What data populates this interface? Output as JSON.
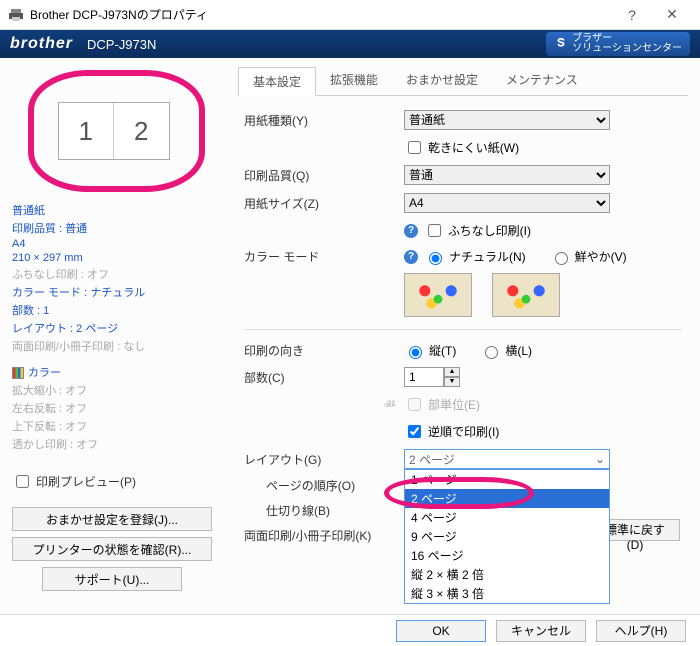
{
  "titlebar": {
    "title": "Brother DCP-J973Nのプロパティ"
  },
  "brandbar": {
    "brand": "brother",
    "model": "DCP-J973N",
    "support": "ブラザー\nソリューションセンター"
  },
  "tabs": [
    "基本設定",
    "拡張機能",
    "おまかせ設定",
    "メンテナンス"
  ],
  "preview": {
    "p1": "1",
    "p2": "2"
  },
  "summary": {
    "media": "普通紙",
    "quality": "印刷品質 : 普通",
    "size": "A4",
    "dim": "210 × 297 mm",
    "borderless": "ふちなし印刷 : オフ",
    "colormode": "カラー モード : ナチュラル",
    "copies": "部数 : 1",
    "layout": "レイアウト : 2 ページ",
    "duplex": "両面印刷/小冊子印刷 : なし",
    "color_head": "カラー",
    "scale": "拡大縮小 : オフ",
    "mirror": "左右反転 : オフ",
    "flip": "上下反転 : オフ",
    "watermark": "透かし印刷 : オフ"
  },
  "left": {
    "preview_chk": "印刷プレビュー(P)",
    "btn1": "おまかせ設定を登録(J)...",
    "btn2": "プリンターの状態を確認(R)...",
    "btn3": "サポート(U)..."
  },
  "labels": {
    "media": "用紙種類(Y)",
    "slowdry": "乾きにくい紙(W)",
    "quality": "印刷品質(Q)",
    "size": "用紙サイズ(Z)",
    "borderless": "ふちなし印刷(I)",
    "colormode": "カラー モード",
    "natural": "ナチュラル(N)",
    "vivid": "鮮やか(V)",
    "orient": "印刷の向き",
    "portrait": "縦(T)",
    "landscape": "横(L)",
    "copies": "部数(C)",
    "collate": "部単位(E)",
    "reverse": "逆順で印刷(I)",
    "layout": "レイアウト(G)",
    "pageorder": "ページの順序(O)",
    "border": "仕切り線(B)",
    "duplex": "両面印刷/小冊子印刷(K)",
    "defaults": "標準に戻す(D)"
  },
  "values": {
    "media": "普通紙",
    "quality": "普通",
    "size": "A4",
    "copies": "1",
    "layout_selected": "2 ページ"
  },
  "layout_options": [
    "1 ページ",
    "2 ページ",
    "4 ページ",
    "9 ページ",
    "16 ページ",
    "縦 2 × 横 2 倍",
    "縦 3 × 横 3 倍"
  ],
  "footer": {
    "ok": "OK",
    "cancel": "キャンセル",
    "help": "ヘルプ(H)"
  }
}
